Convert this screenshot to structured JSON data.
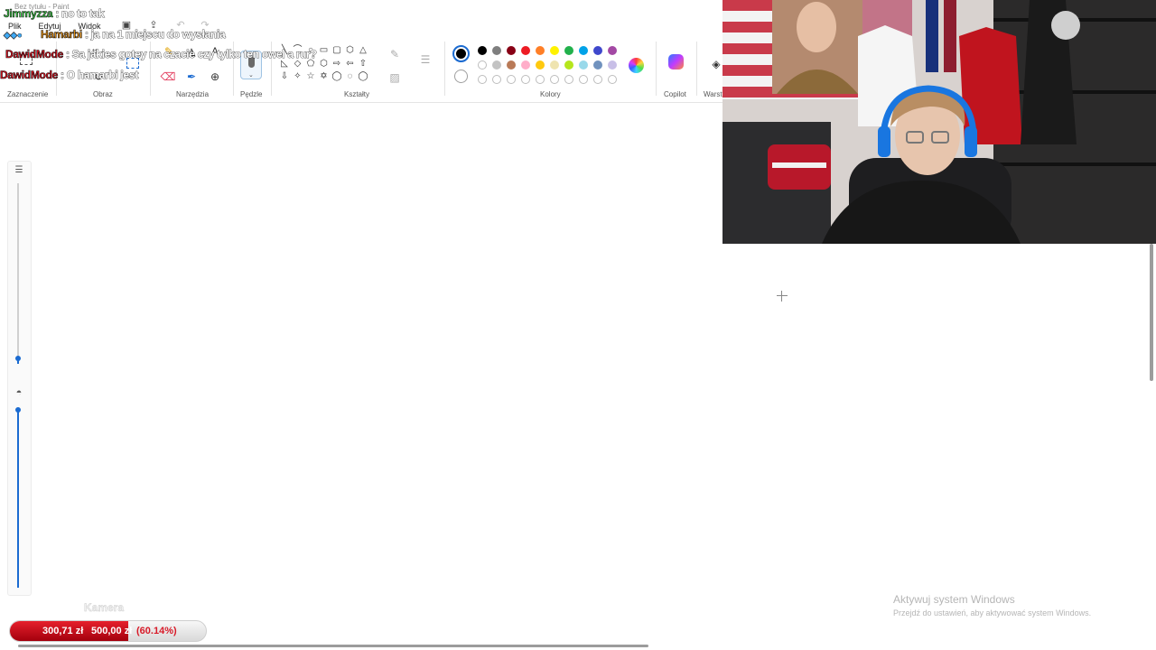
{
  "window": {
    "title": "Bez tytułu - Paint",
    "menu": [
      "Plik",
      "Edytuj",
      "Widok"
    ]
  },
  "ribbon": {
    "groups": [
      "Zaznaczenie",
      "Obraz",
      "Narzędzia",
      "Pędzle",
      "Kształty",
      "Kolory",
      "Copilot",
      "Warst"
    ],
    "palette_row1": [
      "#000000",
      "#7f7f7f",
      "#880015",
      "#ed1c24",
      "#ff7f27",
      "#fff200",
      "#22b14c",
      "#00a2e8",
      "#3f48cc",
      "#a349a4"
    ],
    "palette_row2": [
      "",
      "#c3c3c3",
      "#b97a57",
      "#ffaec9",
      "#ffc90e",
      "#efe4b0",
      "#b5e61d",
      "#99d9ea",
      "#7092be",
      "#c8bfe7"
    ],
    "primary_color": "#000000",
    "accent": "#1b6bd1"
  },
  "chat": [
    {
      "nick": "Jimmyzza",
      "nick_color": "#3fd24b",
      "message": ": no to tak"
    },
    {
      "nick": "Hamarbi",
      "nick_color": "#e08b0f",
      "message": ": ja na 1 miejscu do wysłania"
    },
    {
      "nick": "DawidMode",
      "nick_color": "#e0101e",
      "message": ": Sa jakies gotey na czacie czy tylko ten owel a rur?"
    },
    {
      "nick": "DawidMode",
      "nick_color": "#e0101e",
      "message": ": O hamarbi jest"
    }
  ],
  "windows_activation": {
    "title": "Aktywuj system Windows",
    "subtitle": "Przejdź do ustawień, aby aktywować system Windows."
  },
  "overlay": {
    "camera_label": "Kamera",
    "donation_current": "300,71 zł",
    "donation_goal": "500,00 zł",
    "donation_percent": "(60.14%)",
    "donation_progress": 0.6014,
    "donation_color": "#e6202c"
  }
}
